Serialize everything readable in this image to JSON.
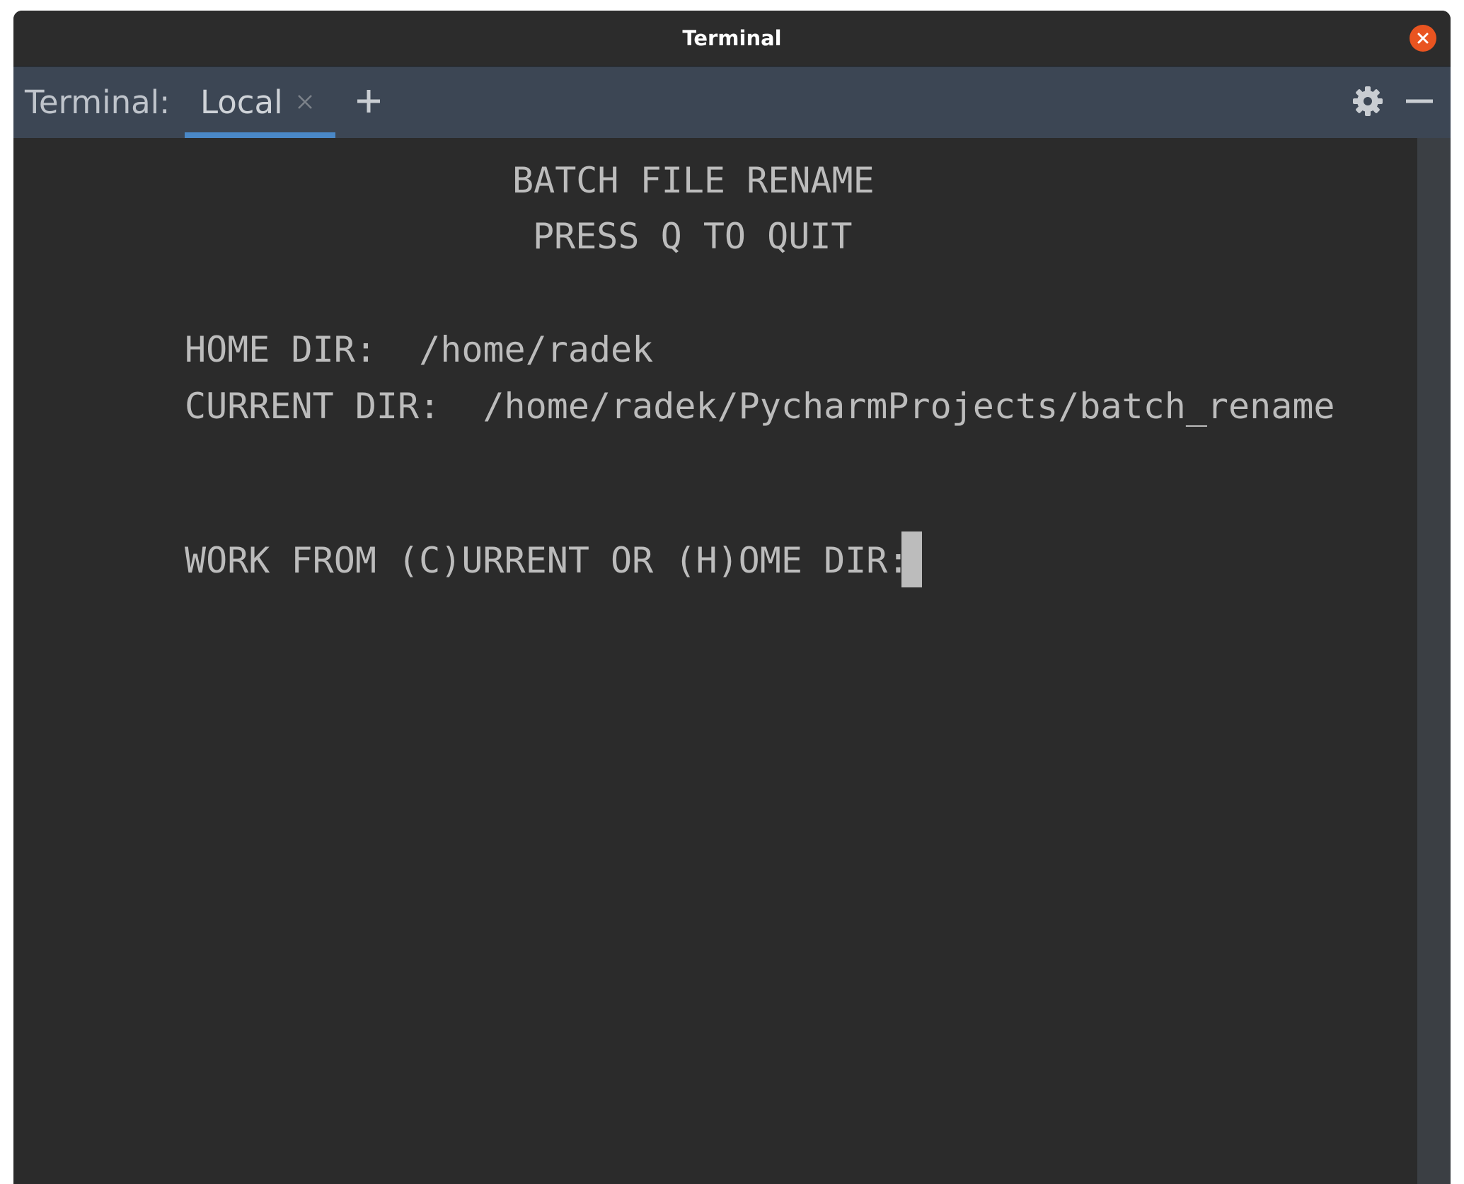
{
  "window": {
    "title": "Terminal"
  },
  "tabbar": {
    "label": "Terminal:",
    "tabs": [
      {
        "label": "Local",
        "active": true
      }
    ]
  },
  "icons": {
    "close": "close-icon",
    "tab_close": "tab-close-icon",
    "add_tab": "plus-icon",
    "settings": "gear-icon",
    "minimize": "minimize-icon"
  },
  "terminal": {
    "lines": [
      "BATCH FILE RENAME",
      "PRESS Q TO QUIT",
      "HOME DIR:  /home/radek",
      "CURRENT DIR:  /home/radek/PycharmProjects/batch_rename",
      "WORK FROM (C)URRENT OR (H)OME DIR: "
    ]
  },
  "colors": {
    "titlebar_bg": "#2c2c2c",
    "tabbar_bg": "#3c4654",
    "terminal_bg": "#2b2b2b",
    "terminal_text": "#bcbcbc",
    "tab_underline": "#4a88c7",
    "close_button": "#e95420"
  }
}
